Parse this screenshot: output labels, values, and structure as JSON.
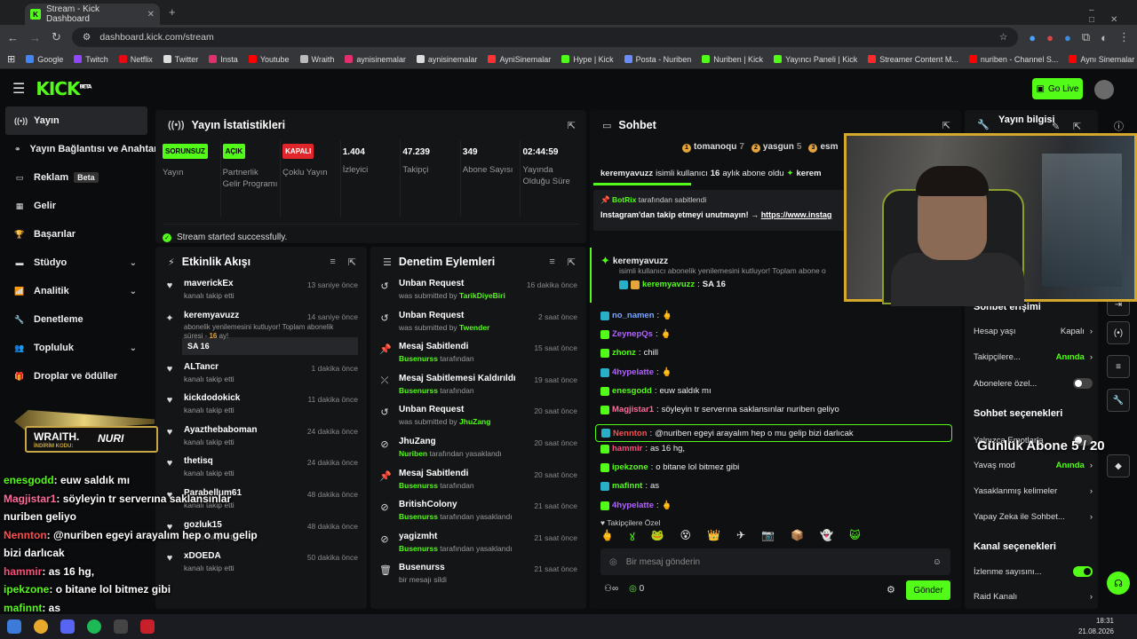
{
  "browser": {
    "tab_title": "Stream - Kick Dashboard",
    "url": "dashboard.kick.com/stream",
    "bookmarks": [
      "Google",
      "Twitch",
      "Netflix",
      "Twitter",
      "Insta",
      "Youtube",
      "Wraith",
      "aynisinemalar",
      "aynisinemalar",
      "AyniSinemalar",
      "Hype | Kick",
      "Posta - Nuriben",
      "Nuriben | Kick",
      "Yayıncı Paneli | Kick",
      "Streamer Content M...",
      "nuriben - Channel S...",
      "Aynı Sinemalar - Ça..."
    ]
  },
  "header": {
    "logo": "KICK",
    "logo_sup": "BETA",
    "go_live": "Go Live"
  },
  "sidebar": {
    "items": [
      {
        "label": "Yayın",
        "icon": "broadcast-icon"
      },
      {
        "label": "Yayın Bağlantısı ve Anahtarı",
        "icon": "link-icon"
      },
      {
        "label": "Reklam",
        "icon": "ad-icon",
        "badge": "Beta"
      },
      {
        "label": "Gelir",
        "icon": "chart-icon"
      },
      {
        "label": "Başarılar",
        "icon": "trophy-icon"
      },
      {
        "label": "Stüdyo",
        "icon": "studio-icon"
      },
      {
        "label": "Analitik",
        "icon": "analytics-icon"
      },
      {
        "label": "Denetleme",
        "icon": "wrench-icon"
      },
      {
        "label": "Topluluk",
        "icon": "community-icon"
      },
      {
        "label": "Droplar ve ödüller",
        "icon": "gift-icon"
      }
    ]
  },
  "stats": {
    "title": "Yayın İstatistikleri",
    "cols": [
      {
        "badge": "SORUNSUZ",
        "label": "Yayın",
        "badge_color": "#53fc18"
      },
      {
        "badge": "AÇIK",
        "label": "Partnerlik Gelir Programı",
        "badge_color": "#53fc18"
      },
      {
        "badge": "KAPALI",
        "label": "Çoklu Yayın",
        "badge_color": "#e0262b"
      },
      {
        "value": "1.404",
        "label": "İzleyici"
      },
      {
        "value": "47.239",
        "label": "Takipçi"
      },
      {
        "value": "349",
        "label": "Abone Sayısı"
      },
      {
        "value": "02:44:59",
        "label": "Yayında Olduğu Süre"
      }
    ],
    "status": "Stream started successfully."
  },
  "activity": {
    "title": "Etkinlik Akışı",
    "items": [
      {
        "name": "maverickEx",
        "sub": "kanalı takip etti",
        "time": "13 saniye önce"
      },
      {
        "name": "keremyavuzz",
        "sub": "abonelik yenilemesini kutluyor! Toplam abonelik süresi - ",
        "sub2": "16",
        "sub3": " ay!",
        "time": "14 saniye önce",
        "extra": "SA 16"
      },
      {
        "name": "ALTancr",
        "sub": "kanalı takip etti",
        "time": "1 dakika önce"
      },
      {
        "name": "kickdodokick",
        "sub": "kanalı takip etti",
        "time": "11 dakika önce"
      },
      {
        "name": "Ayazthebaboman",
        "sub": "kanalı takip etti",
        "time": "24 dakika önce"
      },
      {
        "name": "thetisq",
        "sub": "kanalı takip etti",
        "time": "24 dakika önce"
      },
      {
        "name": "Parabellum61",
        "sub": "kanalı takip etti",
        "time": "48 dakika önce"
      },
      {
        "name": "gozluk15",
        "sub": "kanalı takip etti",
        "time": "48 dakika önce"
      },
      {
        "name": "xDOEDA",
        "sub": "kanalı takip etti",
        "time": "50 dakika önce"
      }
    ]
  },
  "moderation": {
    "title": "Denetim Eylemleri",
    "items": [
      {
        "title": "Unban Request",
        "pre": "was submitted by ",
        "who": "TarikDiyeBiri",
        "post": "",
        "time": "16 dakika önce",
        "icon": "undo-icon"
      },
      {
        "title": "Unban Request",
        "pre": "was submitted by ",
        "who": "Twender",
        "post": "",
        "time": "2 saat önce",
        "icon": "undo-icon"
      },
      {
        "title": "Mesaj Sabitlendi",
        "pre": "",
        "who": "Busenurss",
        "post": " tarafından",
        "time": "15 saat önce",
        "icon": "pin-icon"
      },
      {
        "title": "Mesaj Sabitlemesi Kaldırıldı",
        "pre": "",
        "who": "Busenurss",
        "post": " tarafından",
        "time": "19 saat önce",
        "icon": "unpin-icon"
      },
      {
        "title": "Unban Request",
        "pre": "was submitted by ",
        "who": "JhuZang",
        "post": "",
        "time": "20 saat önce",
        "icon": "undo-icon"
      },
      {
        "title": "JhuZang",
        "pre": "",
        "who": "Nuriben",
        "post": " tarafından yasaklandı",
        "time": "20 saat önce",
        "icon": "ban-icon"
      },
      {
        "title": "Mesaj Sabitlendi",
        "pre": "",
        "who": "Busenurss",
        "post": " tarafından",
        "time": "20 saat önce",
        "icon": "pin-icon"
      },
      {
        "title": "BritishColony",
        "pre": "",
        "who": "Busenurss",
        "post": " tarafından yasaklandı",
        "time": "21 saat önce",
        "icon": "ban-icon"
      },
      {
        "title": "yagizmht",
        "pre": "",
        "who": "Busenurss",
        "post": " tarafından yasaklandı",
        "time": "21 saat önce",
        "icon": "ban-icon"
      },
      {
        "title": "Busenurss",
        "pre": "",
        "who": "",
        "post": "bir mesajı sildi",
        "time": "21 saat önce",
        "icon": "trash-icon"
      }
    ]
  },
  "chat": {
    "title": "Sohbet",
    "top_gifters": [
      {
        "name": "tomanoqu",
        "n": "7"
      },
      {
        "name": "yasgun",
        "n": "5"
      },
      {
        "name": "esm",
        "n": ""
      }
    ],
    "sub_banner": {
      "user": "keremyavuzz",
      "text": " isimli kullanıcı ",
      "n": "16",
      "text2": " aylık abone oldu",
      "user2": "kerem"
    },
    "pinned": {
      "by": "BotRix",
      "by_text": " tarafından sabitlendi",
      "text": "Instagram'dan takip etmeyi unutmayın! → ",
      "link": "https://www.instag"
    },
    "resub": {
      "user": "keremyavuzz",
      "text": "isimli kullanıcı abonelik yenilemesini kutluyor! Toplam abone o",
      "msg_user": "keremyavuzz",
      "msg": "SA 16"
    },
    "messages": [
      {
        "user": "no_namen",
        "text": "",
        "color": "#7aa7ff"
      },
      {
        "user": "ZeynepQs",
        "text": "",
        "color": "#b163ff"
      },
      {
        "user": "zhonz",
        "text": "chill",
        "color": "#53fc18"
      },
      {
        "user": "4hypelatte",
        "text": "",
        "color": "#b163ff"
      },
      {
        "user": "enesgodd",
        "text": "euw saldık mı",
        "color": "#53fc18"
      },
      {
        "user": "Magjistar1",
        "text": "söyleyin tr serverına saklansınlar nuriben geliyo",
        "color": "#ff6b9a"
      },
      {
        "user": "Nennton",
        "text": "@nuriben egeyi arayalım hep o mu gelip bizi darlıcak",
        "color": "#ff4d4d"
      },
      {
        "user": "hammir",
        "text": "as 16 hg,",
        "color": "#ff4d7a"
      },
      {
        "user": "ipekzone",
        "text": "o bitane lol bitmez gibi",
        "color": "#53fc18"
      },
      {
        "user": "mafinnt",
        "text": "as",
        "color": "#53fc18"
      },
      {
        "user": "4hypelatte",
        "text": "",
        "color": "#b163ff"
      }
    ],
    "emote_label": "Takipçilere Özel",
    "input_placeholder": "Bir mesaj gönderin",
    "count": "0",
    "send": "Gönder"
  },
  "right": {
    "title": "Yayın bilgisi",
    "access_title": "Sohbet erişimi",
    "access": [
      {
        "label": "Hesap yaşı",
        "value": "Kapalı"
      },
      {
        "label": "Takipçilere...",
        "value": "Anında"
      },
      {
        "label": "Abonelere özel...",
        "value": ""
      }
    ],
    "options_title": "Sohbet seçenekleri",
    "options": [
      {
        "label": "Yalnızca Emotlarla",
        "value": ""
      },
      {
        "label": "Yavaş mod",
        "value": "Anında"
      },
      {
        "label": "Yasaklanmış kelimeler",
        "value": ""
      },
      {
        "label": "Yapay Zeka ile Sohbet...",
        "value": ""
      }
    ],
    "channel_title": "Kanal seçenekleri",
    "channel": [
      {
        "label": "İzlenme sayısını...",
        "value": ""
      },
      {
        "label": "Raid Kanalı",
        "value": ""
      }
    ]
  },
  "overlay": {
    "wraith_title": "WRAITH.",
    "wraith_code_label": "İNDİRİM KODU:",
    "wraith_code": "NURI",
    "sub_goal": "Günlük Abone 5 / 20",
    "lines": [
      {
        "user": "enesgodd",
        "text": ": euw saldık mı",
        "color": "#53fc18"
      },
      {
        "user": "Magjistar1",
        "text": ": söyleyin tr serverına saklansınlar",
        "color": "#ff6b9a"
      },
      {
        "user": "",
        "text": "nuriben geliyo",
        "color": "#fff"
      },
      {
        "user": "Nennton",
        "text": ": @nuriben egeyi arayalım hep o mu gelip",
        "color": "#ff4d4d"
      },
      {
        "user": "",
        "text": "bizi darlıcak",
        "color": "#fff"
      },
      {
        "user": "hammir",
        "text": ": as 16 hg,",
        "color": "#ff4d7a"
      },
      {
        "user": "ipekzone",
        "text": ": o bitane lol bitmez gibi",
        "color": "#53fc18"
      },
      {
        "user": "mafinnt",
        "text": ": as",
        "color": "#53fc18"
      },
      {
        "user": "4hypelatte",
        "text": ":",
        "color": "#b163ff"
      }
    ]
  },
  "taskbar": {
    "time": "18:31",
    "date": "21.08.2026"
  }
}
